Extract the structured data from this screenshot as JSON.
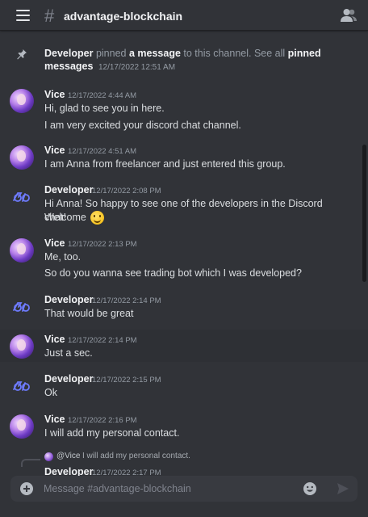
{
  "header": {
    "channel_name": "advantage-blockchain",
    "hash_symbol": "#"
  },
  "system_message": {
    "actor": "Developer",
    "text_before": "pinned",
    "link_text": "a message",
    "text_after": "to this channel. See all",
    "link2_text": "pinned messages",
    "timestamp": "12/17/2022 12:51 AM"
  },
  "messages": [
    {
      "author": "Vice",
      "timestamp": "12/17/2022 4:44 AM",
      "avatar": "vice-avatar",
      "lines": [
        "Hi, glad to see you in here.",
        "I am very excited your discord chat channel."
      ]
    },
    {
      "author": "Vice",
      "timestamp": "12/17/2022 4:51 AM",
      "avatar": "vice-avatar",
      "lines": [
        "I am Anna from freelancer and just entered this group."
      ]
    },
    {
      "author": "Developer",
      "timestamp": "12/17/2022 2:08 PM",
      "avatar": "developer-avatar",
      "lines": [
        "Hi Anna! So happy to see one of the developers in the Discord chat!",
        "Welcome"
      ],
      "emoji": "slightly-smiling-face"
    },
    {
      "author": "Vice",
      "timestamp": "12/17/2022 2:13 PM",
      "avatar": "vice-avatar",
      "lines": [
        "Me, too.",
        "So do you wanna see trading bot which I was developed?"
      ]
    },
    {
      "author": "Developer",
      "timestamp": "12/17/2022 2:14 PM",
      "avatar": "developer-avatar",
      "lines": [
        "That would be great"
      ]
    },
    {
      "author": "Vice",
      "timestamp": "12/17/2022 2:14 PM",
      "avatar": "vice-avatar",
      "lines": [
        "Just a sec."
      ]
    },
    {
      "author": "Developer",
      "timestamp": "12/17/2022 2:15 PM",
      "avatar": "developer-avatar",
      "lines": [
        "Ok"
      ]
    },
    {
      "author": "Vice",
      "timestamp": "12/17/2022 2:16 PM",
      "avatar": "vice-avatar",
      "lines": [
        "I will add my personal contact."
      ]
    },
    {
      "author": "Developer",
      "timestamp": "12/17/2022 2:17 PM",
      "avatar": "developer-avatar",
      "reply": {
        "name": "@Vice",
        "text": "I will add my personal contact."
      }
    }
  ],
  "composer": {
    "placeholder": "Message #advantage-blockchain"
  },
  "colors": {
    "background": "#313338",
    "composer": "#383a40",
    "text": "#dbdee1",
    "muted": "#949ba4",
    "developer_logo": "#6e7bff"
  }
}
